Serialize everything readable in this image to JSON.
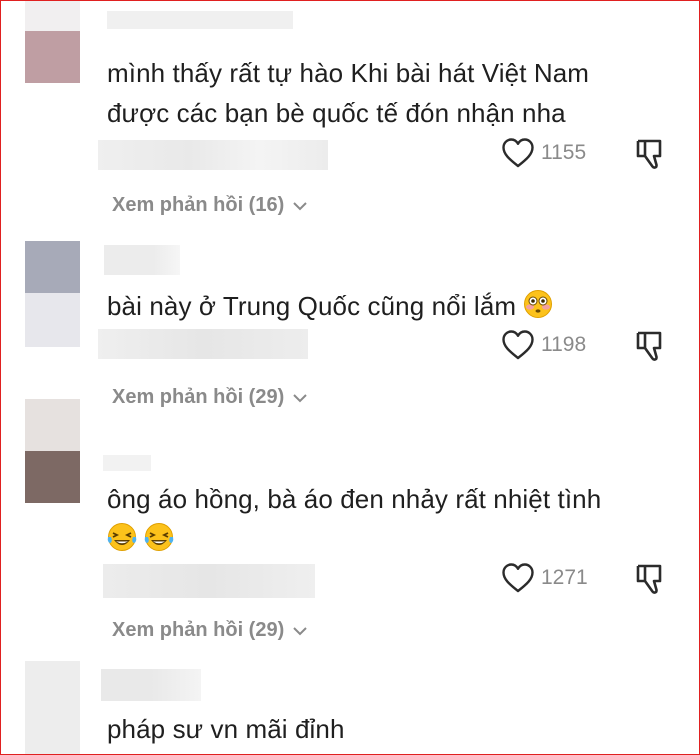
{
  "comments": [
    {
      "text_line1": "mình thấy rất tự hào Khi bài hát Việt Nam",
      "text_line2": "được các bạn bè quốc tế đón nhận nha",
      "likes": "1155",
      "replies": "Xem phản hồi (16)"
    },
    {
      "text_line1": "bài này ở Trung Quốc cũng nổi lắm",
      "emoji": "flushed-face-emoji",
      "likes": "1198",
      "replies": "Xem phản hồi (29)"
    },
    {
      "text_line1": "ông áo hồng, bà áo đen nhảy rất nhiệt tình",
      "emoji": "laughing-tears-emoji",
      "likes": "1271",
      "replies": "Xem phản hồi (29)"
    },
    {
      "text_line1": "pháp sư vn mãi đỉnh"
    }
  ],
  "colors": {
    "frame": "#e02020",
    "text": "#1f1f1f",
    "meta": "#8a8a8a"
  },
  "icons": {
    "like": "heart-outline-icon",
    "dislike": "thumbs-down-outline-icon",
    "expand": "chevron-down-icon"
  }
}
